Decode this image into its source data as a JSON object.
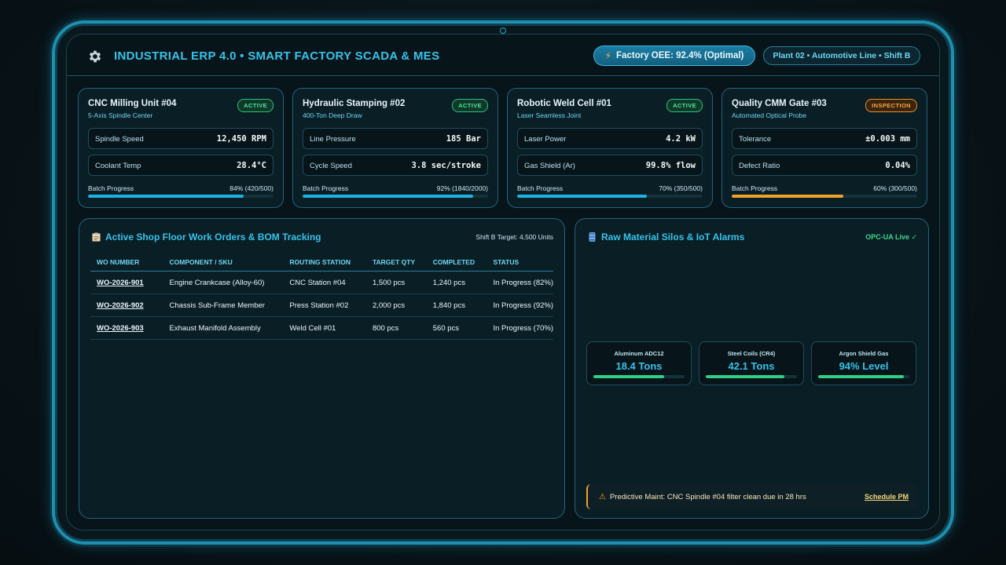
{
  "header": {
    "title": "INDUSTRIAL ERP 4.0 • SMART FACTORY SCADA & MES",
    "oee": "Factory OEE: 92.4% (Optimal)",
    "plant": "Plant 02 • Automotive Line • Shift B"
  },
  "machines": [
    {
      "name": "CNC Milling Unit #04",
      "subtitle": "5-Axis Spindle Center",
      "status": "ACTIVE",
      "metric1": {
        "label": "Spindle Speed",
        "value": "12,450 RPM"
      },
      "metric2": {
        "label": "Coolant Temp",
        "value": "28.4°C"
      },
      "progress_label": "Batch Progress",
      "progress_text": "84% (420/500)",
      "progress": 0.84
    },
    {
      "name": "Hydraulic Stamping #02",
      "subtitle": "400-Ton Deep Draw",
      "status": "ACTIVE",
      "metric1": {
        "label": "Line Pressure",
        "value": "185 Bar"
      },
      "metric2": {
        "label": "Cycle Speed",
        "value": "3.8 sec/stroke"
      },
      "progress_label": "Batch Progress",
      "progress_text": "92% (1840/2000)",
      "progress": 0.92
    },
    {
      "name": "Robotic Weld Cell #01",
      "subtitle": "Laser Seamless Joint",
      "status": "ACTIVE",
      "metric1": {
        "label": "Laser Power",
        "value": "4.2 kW"
      },
      "metric2": {
        "label": "Gas Shield (Ar)",
        "value": "99.8% flow"
      },
      "progress_label": "Batch Progress",
      "progress_text": "70% (350/500)",
      "progress": 0.7
    },
    {
      "name": "Quality CMM Gate #03",
      "subtitle": "Automated Optical Probe",
      "status": "INSPECTION",
      "metric1": {
        "label": "Tolerance",
        "value": "±0.003 mm"
      },
      "metric2": {
        "label": "Defect Ratio",
        "value": "0.04%"
      },
      "progress_label": "Batch Progress",
      "progress_text": "60% (300/500)",
      "progress": 0.6
    }
  ],
  "work_orders": {
    "title": "Active Shop Floor Work Orders & BOM Tracking",
    "target": "Shift B Target: 4,500 Units",
    "columns": [
      "WO NUMBER",
      "COMPONENT / SKU",
      "ROUTING STATION",
      "TARGET QTY",
      "COMPLETED",
      "STATUS"
    ],
    "rows": [
      [
        "WO-2026-901",
        "Engine Crankcase (Alloy-60)",
        "CNC Station #04",
        "1,500 pcs",
        "1,240 pcs",
        "In Progress (82%)"
      ],
      [
        "WO-2026-902",
        "Chassis Sub-Frame Member",
        "Press Station #02",
        "2,000 pcs",
        "1,840 pcs",
        "In Progress (92%)"
      ],
      [
        "WO-2026-903",
        "Exhaust Manifold Assembly",
        "Weld Cell #01",
        "800 pcs",
        "560 pcs",
        "In Progress (70%)"
      ]
    ]
  },
  "silos": {
    "title": "Raw Material Silos & IoT Alarms",
    "status": "OPC-UA Live ✓",
    "items": [
      {
        "name": "Aluminum ADC12",
        "value": "18.4 Tons",
        "level": 0.78
      },
      {
        "name": "Steel Coils (CR4)",
        "value": "42.1 Tons",
        "level": 0.86
      },
      {
        "name": "Argon Shield Gas",
        "value": "94% Level",
        "level": 0.94
      }
    ],
    "alarm": "Predictive Maint: CNC Spindle #04 filter clean due in 28 hrs",
    "alarm_action": "Schedule PM"
  },
  "colors": {
    "accent": "#35c3ea",
    "active": "#3fd98c",
    "warning": "#f0a22a"
  }
}
